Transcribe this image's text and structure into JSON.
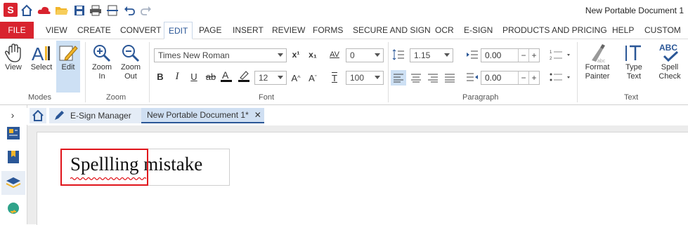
{
  "app": {
    "logo_letter": "S",
    "window_title": "New Portable Document 1"
  },
  "menu": {
    "file": "FILE",
    "items": [
      "VIEW",
      "CREATE",
      "CONVERT",
      "EDIT",
      "PAGE",
      "INSERT",
      "REVIEW",
      "FORMS",
      "SECURE AND SIGN",
      "OCR",
      "E-SIGN",
      "PRODUCTS AND PRICING",
      "HELP",
      "CUSTOM"
    ],
    "active": "EDIT"
  },
  "ribbon": {
    "modes": {
      "view": "View",
      "select": "Select",
      "edit": "Edit",
      "label": "Modes"
    },
    "zoom": {
      "zoom_in": "Zoom In",
      "zoom_out": "Zoom Out",
      "label": "Zoom"
    },
    "font": {
      "family": "Times New Roman",
      "size": "12",
      "char_spacing": "0",
      "scale": "100",
      "label": "Font",
      "superscript": "x¹",
      "subscript": "x₁"
    },
    "paragraph": {
      "line_spacing": "1.15",
      "indent_top": "0.00",
      "indent_bottom": "0.00",
      "label": "Paragraph"
    },
    "text": {
      "format_painter": "Format Painter",
      "type_text": "Type Text",
      "spell_check": "Spell Check",
      "label": "Text"
    }
  },
  "tabs": {
    "esign_manager": "E-Sign Manager",
    "document": "New Portable Document 1*"
  },
  "document": {
    "text_first": "Spellling",
    "text_second": " mistake"
  },
  "colors": {
    "accent_red": "#d8232e",
    "brand_blue": "#2b5797",
    "highlight": "#e0141b"
  }
}
